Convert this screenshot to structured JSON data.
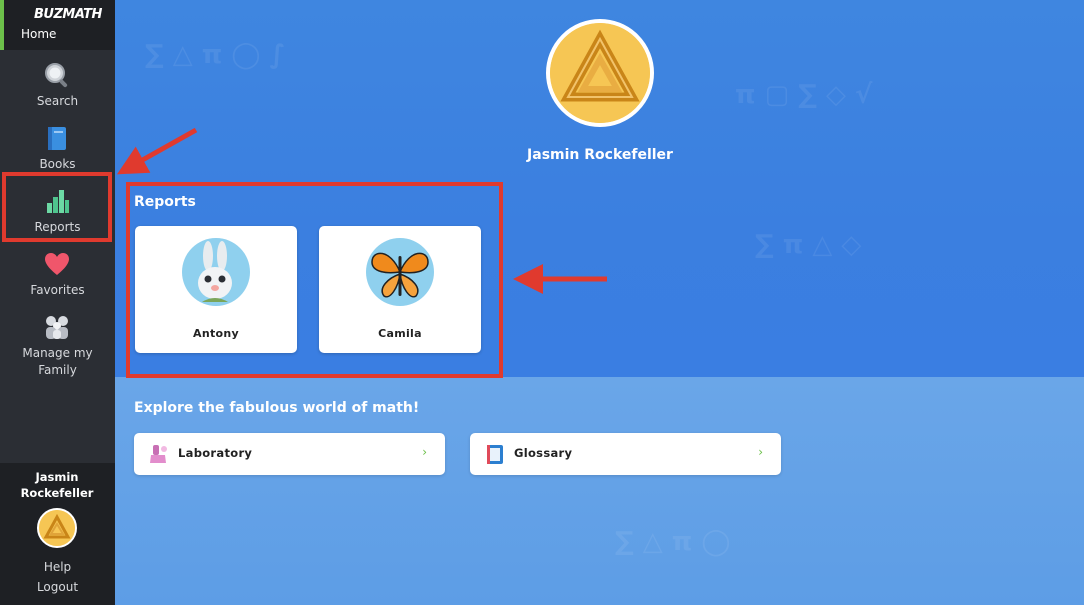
{
  "sidebar": {
    "logo": "BUZMATH",
    "home_label": "Home",
    "items": [
      {
        "label": "Search",
        "icon": "magnifier-icon"
      },
      {
        "label": "Books",
        "icon": "book-icon"
      },
      {
        "label": "Reports",
        "icon": "bar-chart-icon"
      },
      {
        "label": "Favorites",
        "icon": "heart-icon"
      },
      {
        "label": "Manage my Family",
        "icon": "family-icon"
      }
    ],
    "user_name": "Jasmin Rockefeller",
    "help_label": "Help",
    "logout_label": "Logout"
  },
  "profile": {
    "name": "Jasmin Rockefeller"
  },
  "reports": {
    "title": "Reports",
    "children": [
      {
        "name": "Antony",
        "avatar": "bunny-avatar"
      },
      {
        "name": "Camila",
        "avatar": "butterfly-avatar"
      }
    ]
  },
  "explore": {
    "title": "Explore the fabulous world of math!",
    "links": [
      {
        "label": "Laboratory",
        "icon": "lab-icon",
        "chevron": "›"
      },
      {
        "label": "Glossary",
        "icon": "glossary-icon",
        "chevron": "›"
      }
    ]
  },
  "colors": {
    "accent_green": "#6cc04a",
    "annotation_red": "#e03a2e",
    "background_blue": "#3b7fe0"
  }
}
